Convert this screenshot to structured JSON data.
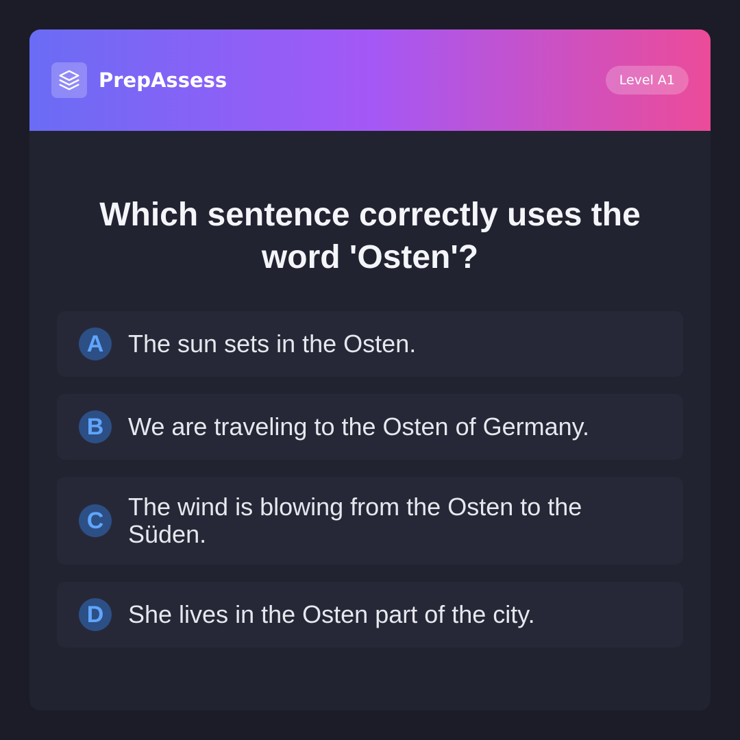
{
  "header": {
    "logo_icon": "layers-icon",
    "brand": "PrepAssess",
    "level": "Level A1",
    "gradient": [
      "#6a6cf5",
      "#a458f6",
      "#ec4b99"
    ]
  },
  "question": {
    "text": "Which sentence correctly uses the word 'Osten'?"
  },
  "options": [
    {
      "letter": "A",
      "text": "The sun sets in the Osten."
    },
    {
      "letter": "B",
      "text": "We are traveling to the Osten of Germany."
    },
    {
      "letter": "C",
      "text": "The wind is blowing from the Osten to the Süden."
    },
    {
      "letter": "D",
      "text": "She lives in the Osten part of the city."
    }
  ],
  "colors": {
    "background": "#1b1c27",
    "card": "#212331",
    "option_bg": "#272837",
    "letter_bg": "#2c4f86",
    "letter_fg": "#60a5fa"
  }
}
